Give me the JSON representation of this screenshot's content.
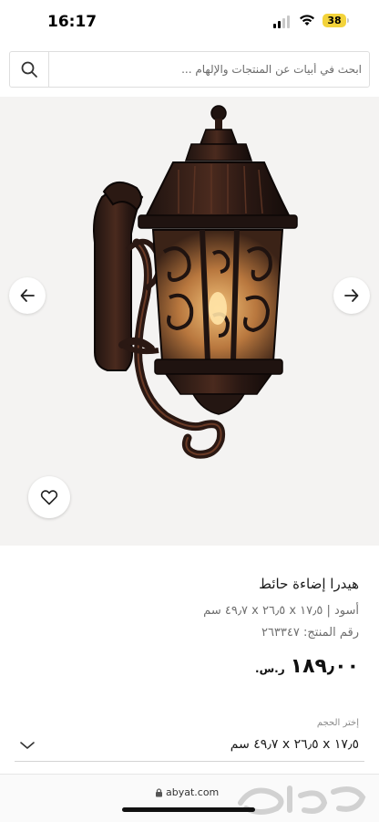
{
  "status_bar": {
    "time": "16:17",
    "battery": "38"
  },
  "search": {
    "placeholder": "ابحث في أبيات عن المنتجات والإلهام ..."
  },
  "product": {
    "title": "هيدرا إضاءة حائط",
    "description": "أسود | ١٧٫٥ x ٢٦٫٥ x ٤٩٫٧ سم",
    "sku": "رقم المنتج: ٢٦٣٣٤٧",
    "price": "١٨٩٫٠٠",
    "currency": "ر.س."
  },
  "size_selector": {
    "label": "إختر الحجم",
    "value": "١٧٫٥ x ٢٦٫٥ x ٤٩٫٧ سم"
  },
  "browser": {
    "url": "abyat.com"
  },
  "icons": {
    "search": "search-icon",
    "prev": "arrow-left-icon",
    "next": "arrow-right-icon",
    "favorite": "heart-icon",
    "dropdown": "chevron-down-icon",
    "lock": "lock-icon"
  },
  "colors": {
    "image_background": "#f4f3f2",
    "battery": "#f3d33b"
  }
}
